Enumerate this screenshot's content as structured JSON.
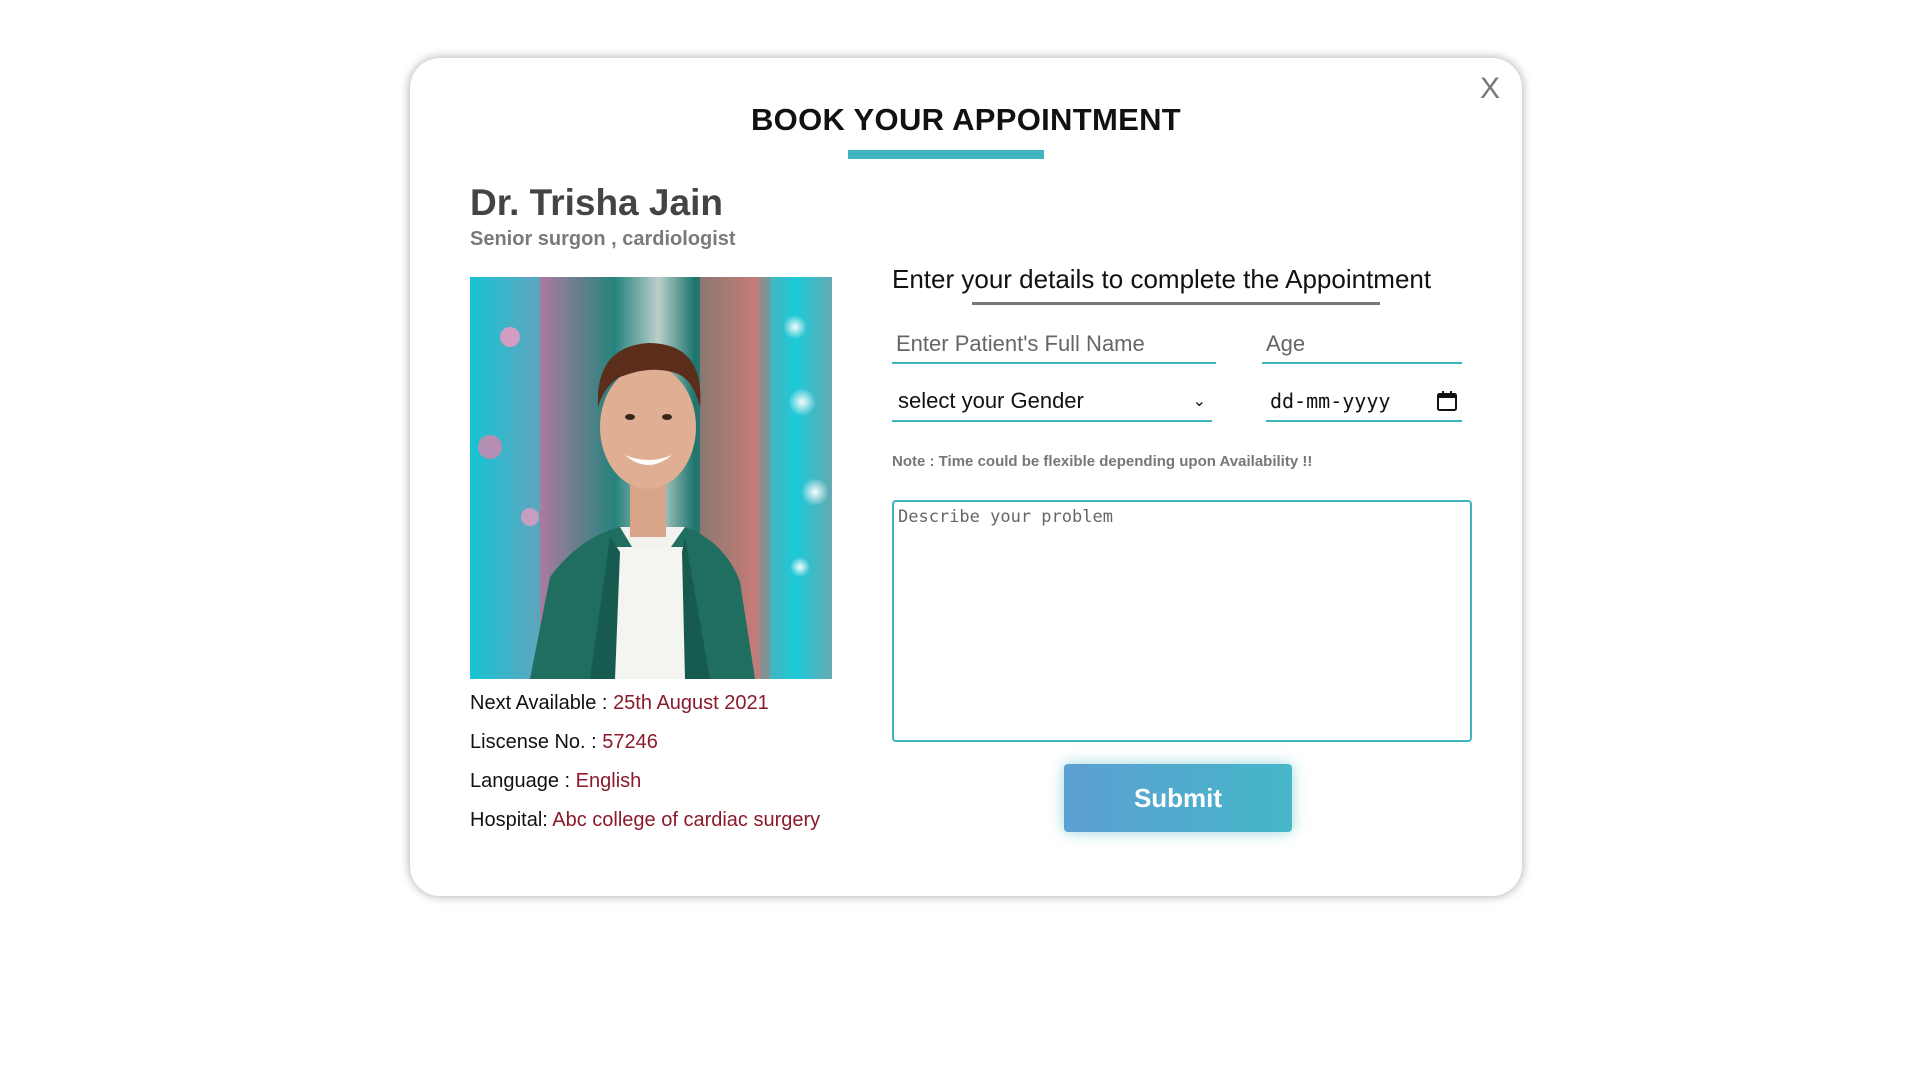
{
  "modal": {
    "close_label": "X",
    "title": "BOOK YOUR APPOINTMENT"
  },
  "doctor": {
    "name": "Dr. Trisha Jain",
    "role": "Senior surgon , cardiologist",
    "next_available_label": "Next Available :",
    "next_available_value": "25th August 2021",
    "license_label": "Liscense No. :",
    "license_value": "57246",
    "language_label": "Language :",
    "language_value": "English",
    "hospital_label": "Hospital:",
    "hospital_value": "Abc college of cardiac surgery"
  },
  "form": {
    "heading": "Enter your details to complete the Appointment",
    "name_placeholder": "Enter Patient's Full Name",
    "age_placeholder": "Age",
    "gender_selected": "select your Gender",
    "date_placeholder": "dd-mm-yyyy",
    "note": "Note : Time could be flexible depending upon Availability !!",
    "problem_placeholder": "Describe your problem",
    "submit_label": "Submit"
  },
  "colors": {
    "accent": "#3fb6bf",
    "value_text": "#8b1a2b",
    "submit_start": "#5c9fd3",
    "submit_end": "#45b7c8"
  },
  "icons": {
    "close": "close-icon",
    "dropdown": "chevron-down-icon",
    "calendar": "calendar-icon"
  }
}
